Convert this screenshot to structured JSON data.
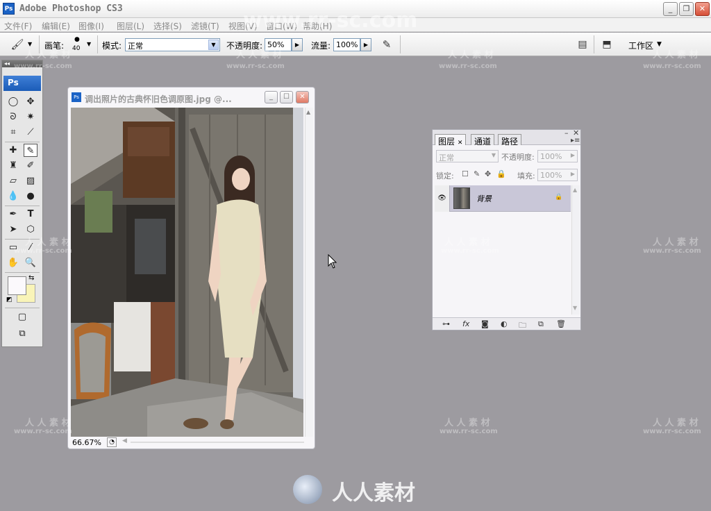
{
  "app": {
    "title": "Adobe Photoshop CS3",
    "logo": "Ps"
  },
  "menu": [
    "文件(F)",
    "编辑(E)",
    "图像(I)",
    "图层(L)",
    "选择(S)",
    "滤镜(T)",
    "视图(V)",
    "窗口(W)",
    "帮助(H)"
  ],
  "options": {
    "brush_label": "画笔:",
    "brush_size": "40",
    "mode_label": "模式:",
    "mode_value": "正常",
    "opacity_label": "不透明度:",
    "opacity_value": "50%",
    "flow_label": "流量:",
    "flow_value": "100%",
    "workspace_label": "工作区"
  },
  "toolbox": {
    "logo": "Ps"
  },
  "document": {
    "title": "调出照片的古典怀旧色调原图.jpg @...",
    "zoom": "66.67%"
  },
  "layers_panel": {
    "tabs": [
      "图层",
      "通道",
      "路径"
    ],
    "blend_mode": "正常",
    "opacity_label": "不透明度:",
    "opacity_value": "100%",
    "lock_label": "锁定:",
    "fill_label": "填充:",
    "fill_value": "100%",
    "layer_name": "背景"
  },
  "watermarks": {
    "large": "www.rr-sc.com",
    "small": "人 人 素 材",
    "url": "www.rr-sc.com",
    "bottom": "人人素材"
  },
  "colors": {
    "workspace": "#9d9ba0",
    "accent": "#1b63c6",
    "layer_selected": "#c9c7d8",
    "background_swatch": "#fbf9fc",
    "foreground_swatch": "#f9f4b8"
  }
}
